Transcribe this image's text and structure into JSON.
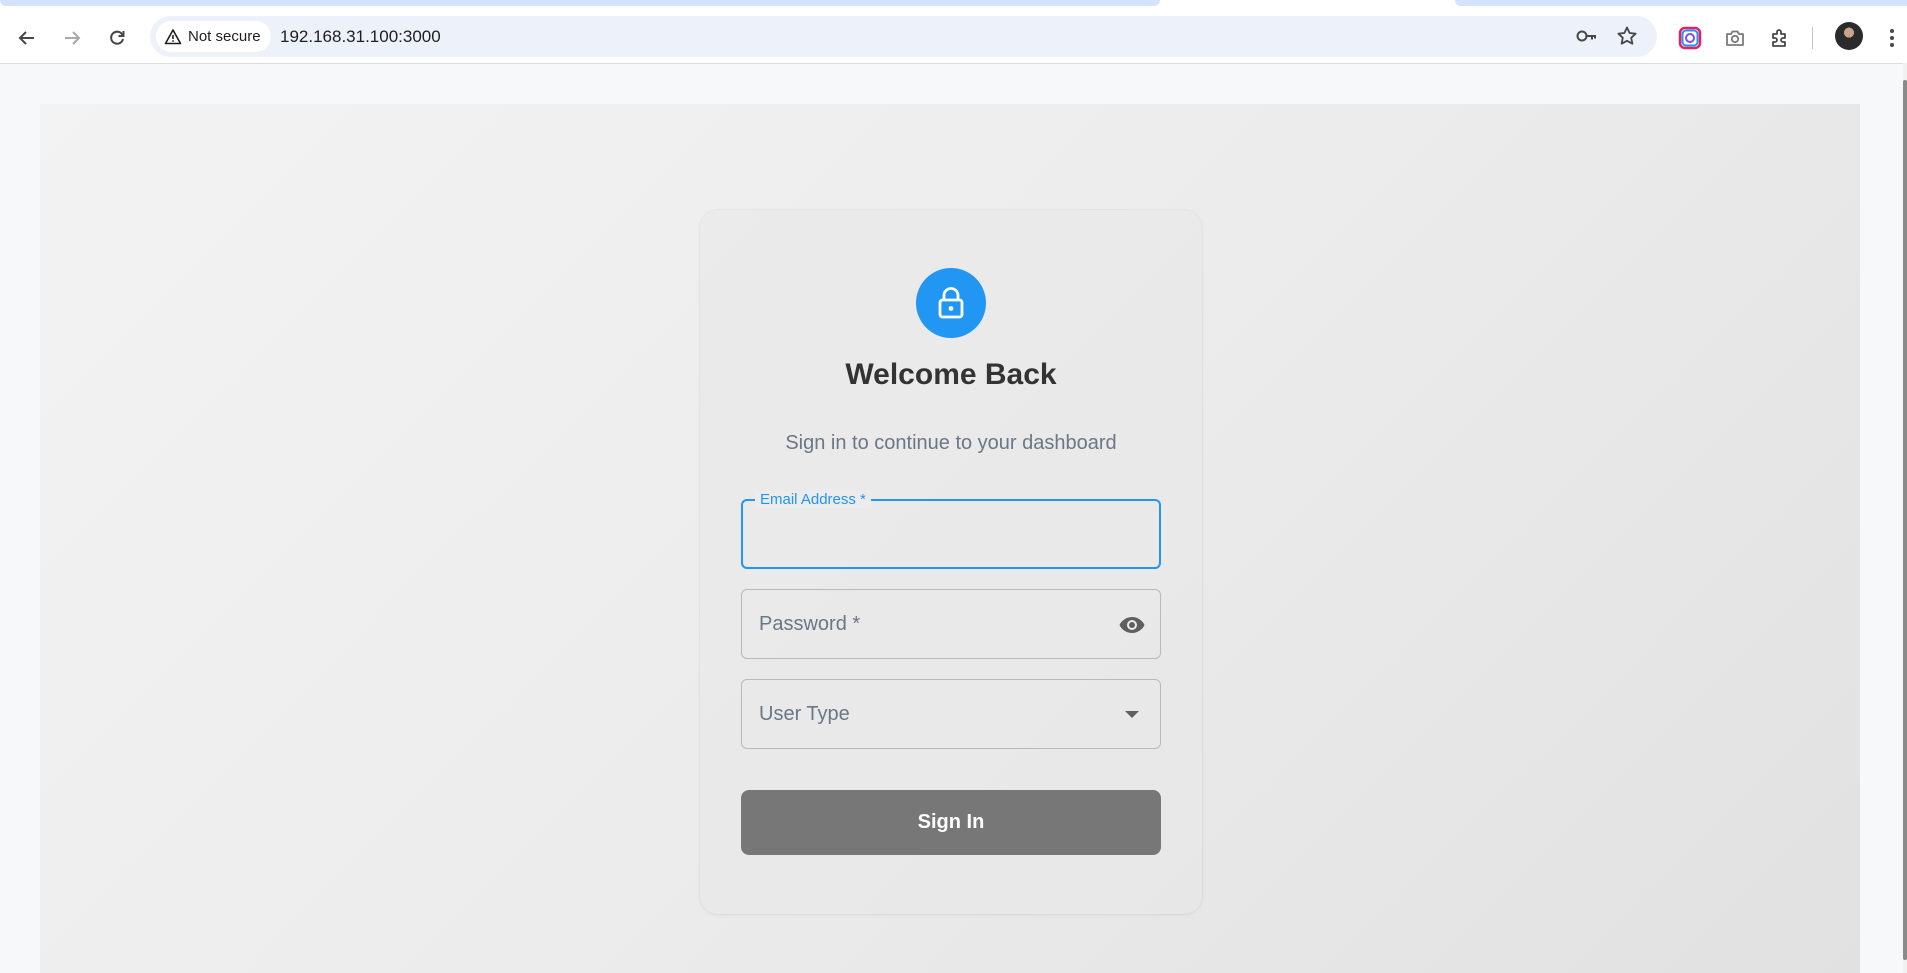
{
  "browser": {
    "security_chip": "Not secure",
    "url": "192.168.31.100:3000",
    "icons": [
      "back-icon",
      "forward-icon",
      "reload-icon",
      "key-icon",
      "star-icon",
      "color-extension-icon",
      "camera-icon",
      "extensions-puzzle-icon",
      "profile-avatar",
      "kebab-menu-icon"
    ]
  },
  "login": {
    "title": "Welcome Back",
    "subtitle": "Sign in to continue to your dashboard",
    "email": {
      "label": "Email Address *",
      "value": ""
    },
    "password": {
      "label": "Password *",
      "value": ""
    },
    "user_type": {
      "label": "User Type",
      "value": ""
    },
    "submit_label": "Sign In"
  },
  "colors": {
    "accent": "#2196f3",
    "button": "#777777",
    "title_text": "#333333",
    "muted_text": "#6b7785"
  }
}
